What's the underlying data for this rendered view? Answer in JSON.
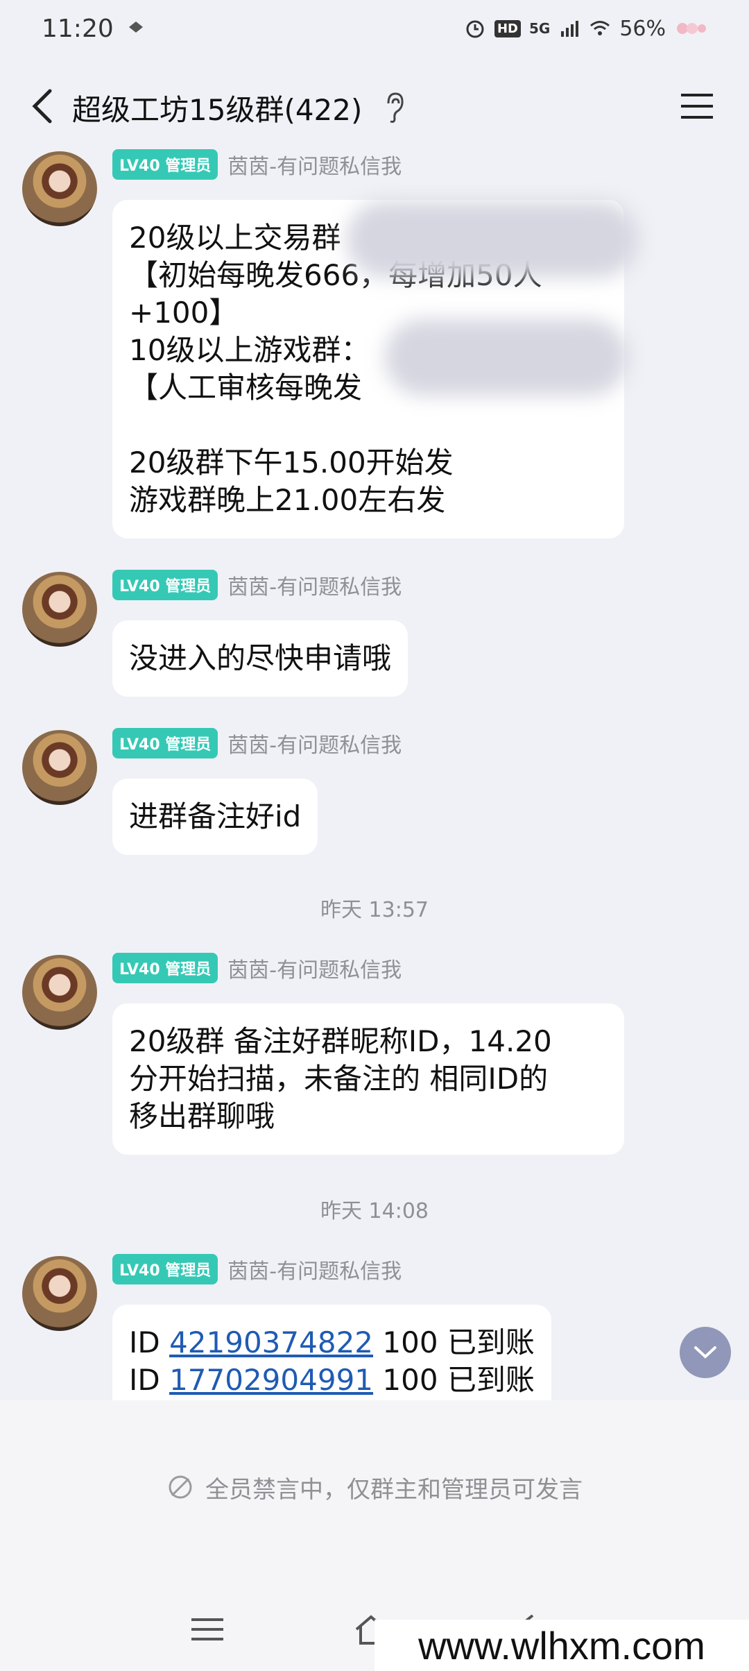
{
  "status_bar": {
    "time": "11:20",
    "signal": "5G",
    "hd": "HD",
    "battery": "56%"
  },
  "header": {
    "title": "超级工坊15级群(422)"
  },
  "messages": [
    {
      "badge": "LV40 管理员",
      "nick": "茵茵-有问题私信我",
      "lines": [
        "20级以上交易群",
        "【初始每晚发666，每增加50人",
        "+100】",
        "10级以上游戏群：",
        "【人工审核每晚发",
        "",
        "20级群下午15.00开始发",
        "游戏群晚上21.00左右发"
      ]
    },
    {
      "badge": "LV40 管理员",
      "nick": "茵茵-有问题私信我",
      "lines": [
        "没进入的尽快申请哦"
      ]
    },
    {
      "badge": "LV40 管理员",
      "nick": "茵茵-有问题私信我",
      "lines": [
        "进群备注好id"
      ]
    },
    {
      "timestamp": "昨天 13:57"
    },
    {
      "badge": "LV40 管理员",
      "nick": "茵茵-有问题私信我",
      "lines": [
        "20级群 备注好群昵称ID，14.20",
        "分开始扫描，未备注的 相同ID的",
        "移出群聊哦"
      ]
    },
    {
      "timestamp": "昨天 14:08"
    },
    {
      "badge": "LV40 管理员",
      "nick": "茵茵-有问题私信我",
      "rows": [
        {
          "prefix": "ID ",
          "id": "42190374822",
          "suffix": " 100 已到账"
        },
        {
          "prefix": "ID ",
          "id": "17702904991",
          "suffix": " 100 已到账"
        }
      ]
    }
  ],
  "mute_notice": "全员禁言中，仅群主和管理员可发言",
  "watermark": "www.wlhxm.com",
  "colors": {
    "background": "#f0f1f6",
    "badge": "#35c9b5",
    "link": "#1f5bb3"
  }
}
